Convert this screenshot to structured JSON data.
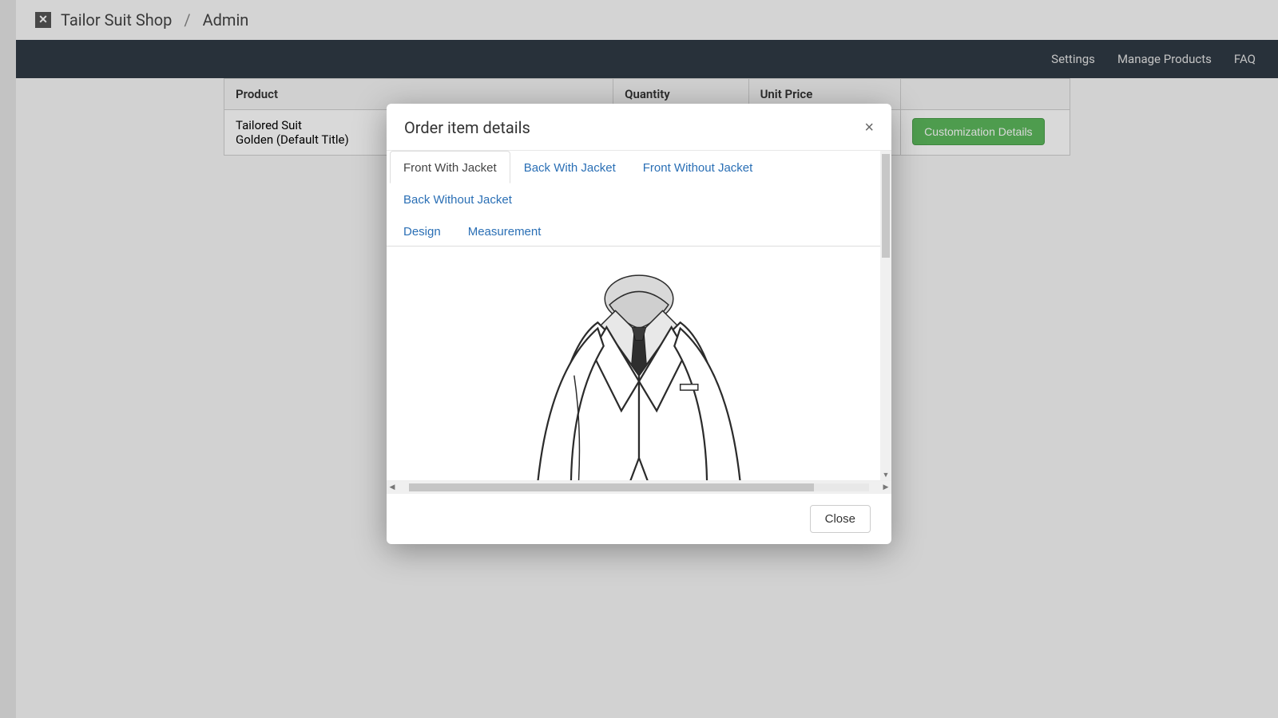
{
  "breadcrumb": {
    "app": "Tailor Suit Shop",
    "page": "Admin"
  },
  "navbar": {
    "settings": "Settings",
    "manage_products": "Manage Products",
    "faq": "FAQ"
  },
  "table": {
    "headers": {
      "product": "Product",
      "quantity": "Quantity",
      "unit_price": "Unit Price"
    },
    "rows": [
      {
        "product_line1": "Tailored Suit",
        "product_line2": "Golden (Default Title)",
        "action_label": "Customization Details"
      }
    ]
  },
  "modal": {
    "title": "Order item details",
    "close_icon": "×",
    "tabs": [
      "Front With Jacket",
      "Back With Jacket",
      "Front Without Jacket",
      "Back Without Jacket",
      "Design",
      "Measurement"
    ],
    "active_tab_index": 0,
    "close_button": "Close"
  }
}
